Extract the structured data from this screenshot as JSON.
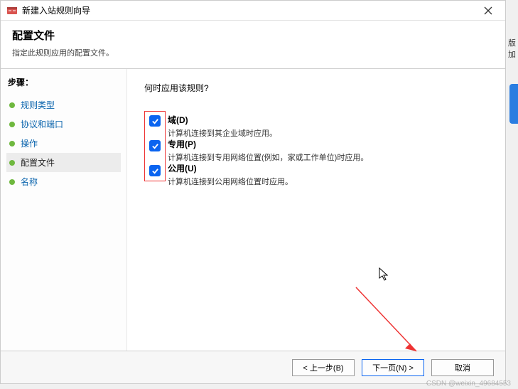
{
  "titlebar": {
    "title": "新建入站规则向导"
  },
  "header": {
    "title": "配置文件",
    "subtitle": "指定此规则应用的配置文件。"
  },
  "sidebar": {
    "steps_label": "步骤：",
    "items": [
      {
        "label": "规则类型"
      },
      {
        "label": "协议和端口"
      },
      {
        "label": "操作"
      },
      {
        "label": "配置文件"
      },
      {
        "label": "名称"
      }
    ],
    "active_index": 3
  },
  "content": {
    "question": "何时应用该规则?",
    "options": [
      {
        "label": "域(D)",
        "desc": "计算机连接到其企业域时应用。",
        "checked": true
      },
      {
        "label": "专用(P)",
        "desc": "计算机连接到专用网络位置(例如，家或工作单位)时应用。",
        "checked": true
      },
      {
        "label": "公用(U)",
        "desc": "计算机连接到公用网络位置时应用。",
        "checked": true
      }
    ]
  },
  "buttons": {
    "back": "< 上一步(B)",
    "next": "下一页(N) >",
    "cancel": "取消"
  },
  "watermark": "CSDN @weixin_49684553",
  "right_fragment": "版加"
}
